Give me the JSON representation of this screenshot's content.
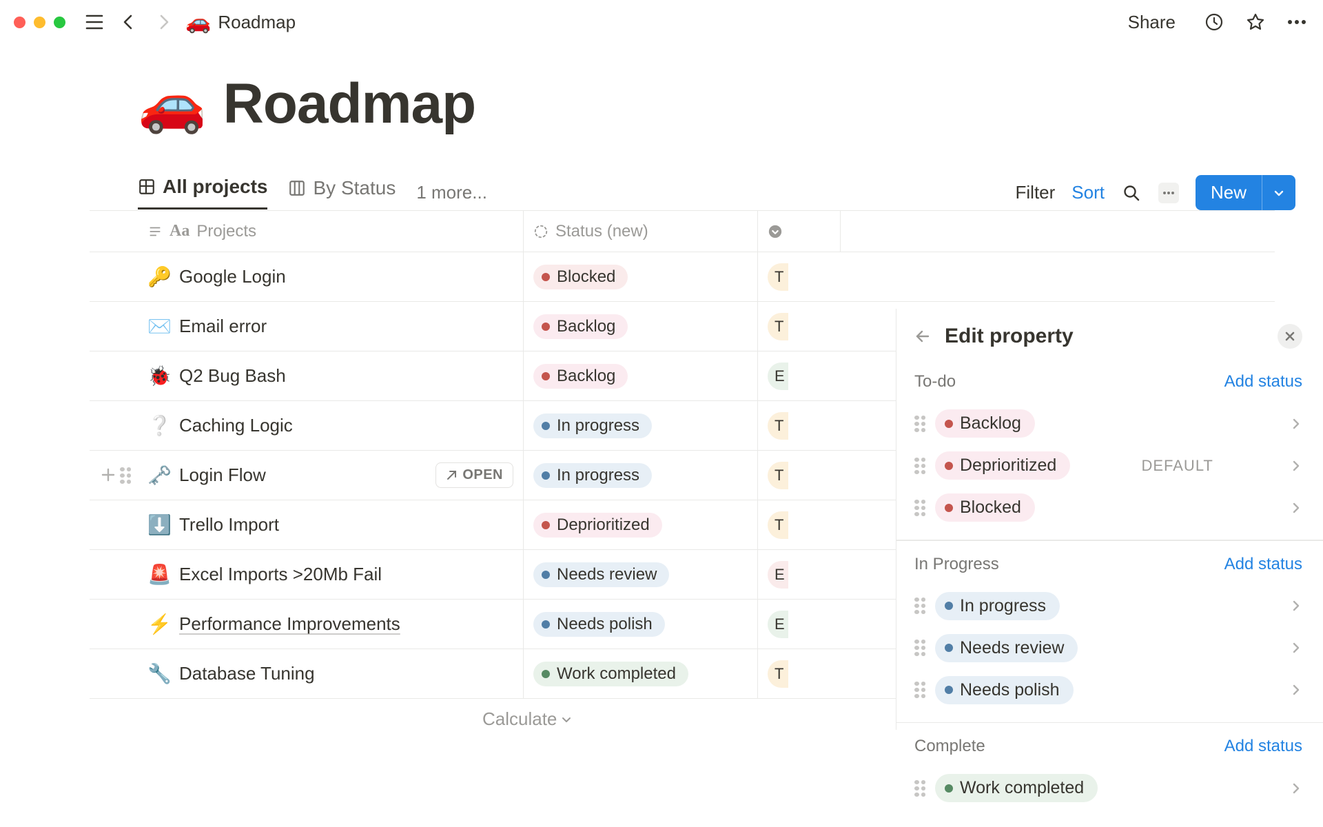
{
  "titlebar": {
    "crumb_emoji": "🚗",
    "crumb_title": "Roadmap",
    "share": "Share"
  },
  "page": {
    "emoji": "🚗",
    "title": "Roadmap"
  },
  "tabs": {
    "t0": "All projects",
    "t1": "By Status",
    "more": "1 more..."
  },
  "controls": {
    "filter": "Filter",
    "sort": "Sort",
    "new": "New"
  },
  "columns": {
    "c0": "Projects",
    "c1": "Status (new)"
  },
  "rows": [
    {
      "emoji": "🔑",
      "name": "Google Login",
      "status": "Blocked",
      "color": "red",
      "p": "T"
    },
    {
      "emoji": "✉️",
      "name": "Email error",
      "status": "Backlog",
      "color": "pink",
      "p": "T"
    },
    {
      "emoji": "🐞",
      "name": "Q2 Bug Bash",
      "status": "Backlog",
      "color": "pink",
      "p": "E",
      "pgreen": true
    },
    {
      "emoji": "❔",
      "name": "Caching Logic",
      "status": "In progress",
      "color": "blue",
      "p": "T"
    },
    {
      "emoji": "🗝️",
      "name": "Login Flow",
      "status": "In progress",
      "color": "blue",
      "p": "T",
      "hover": true
    },
    {
      "emoji": "⬇️",
      "name": "Trello Import",
      "status": "Deprioritized",
      "color": "pink",
      "p": "T"
    },
    {
      "emoji": "🚨",
      "name": "Excel Imports >20Mb Fail",
      "status": "Needs review",
      "color": "blue",
      "p": "E",
      "pred": true
    },
    {
      "emoji": "⚡",
      "name": "Performance Improvements",
      "status": "Needs polish",
      "color": "blue",
      "p": "E",
      "pgreen": true,
      "underline": true
    },
    {
      "emoji": "🔧",
      "name": "Database Tuning",
      "status": "Work completed",
      "color": "green",
      "p": "T"
    }
  ],
  "open_label": "OPEN",
  "calculate": "Calculate",
  "panel": {
    "title": "Edit property",
    "add_status": "Add status",
    "default": "DEFAULT",
    "groups": [
      {
        "name": "To-do",
        "items": [
          {
            "label": "Backlog",
            "color": "pink"
          },
          {
            "label": "Deprioritized",
            "color": "pink",
            "default": true
          },
          {
            "label": "Blocked",
            "color": "pink"
          }
        ]
      },
      {
        "name": "In Progress",
        "items": [
          {
            "label": "In progress",
            "color": "blue"
          },
          {
            "label": "Needs review",
            "color": "blue"
          },
          {
            "label": "Needs polish",
            "color": "blue"
          }
        ]
      },
      {
        "name": "Complete",
        "items": [
          {
            "label": "Work completed",
            "color": "green"
          }
        ]
      }
    ]
  }
}
